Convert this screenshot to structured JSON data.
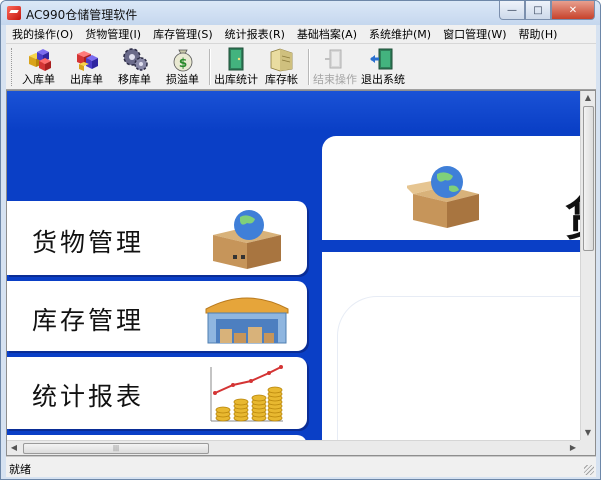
{
  "window": {
    "title": "AC990仓储管理软件",
    "controls": {
      "minimize": "—",
      "maximize": "□",
      "close": "✕"
    }
  },
  "menu": [
    {
      "label": "我的操作(O)"
    },
    {
      "label": "货物管理(I)"
    },
    {
      "label": "库存管理(S)"
    },
    {
      "label": "统计报表(R)"
    },
    {
      "label": "基础档案(A)"
    },
    {
      "label": "系统维护(M)"
    },
    {
      "label": "窗口管理(W)"
    },
    {
      "label": "帮助(H)"
    }
  ],
  "toolbar": {
    "buttons": [
      {
        "label": "入库单",
        "icon": "inbound-cubes-icon",
        "enabled": true
      },
      {
        "label": "出库单",
        "icon": "outbound-cubes-icon",
        "enabled": true
      },
      {
        "label": "移库单",
        "icon": "transfer-gears-icon",
        "enabled": true
      },
      {
        "label": "损溢单",
        "icon": "money-bag-icon",
        "enabled": true
      },
      {
        "label": "出库统计",
        "icon": "door-exit-icon",
        "enabled": true
      },
      {
        "label": "库存帐",
        "icon": "ledger-folder-icon",
        "enabled": true
      },
      {
        "label": "结束操作",
        "icon": "end-operation-icon",
        "enabled": false
      },
      {
        "label": "退出系统",
        "icon": "exit-system-icon",
        "enabled": true
      }
    ]
  },
  "main": {
    "panels": [
      {
        "label": "货物管理",
        "icon": "globe-box-icon"
      },
      {
        "label": "库存管理",
        "icon": "warehouse-icon"
      },
      {
        "label": "统计报表",
        "icon": "coin-chart-icon"
      }
    ],
    "right_heading_char": "货"
  },
  "status": {
    "text": "就绪"
  },
  "colors": {
    "accent_blue": "#0a3fc6",
    "panel_white": "#ffffff"
  }
}
